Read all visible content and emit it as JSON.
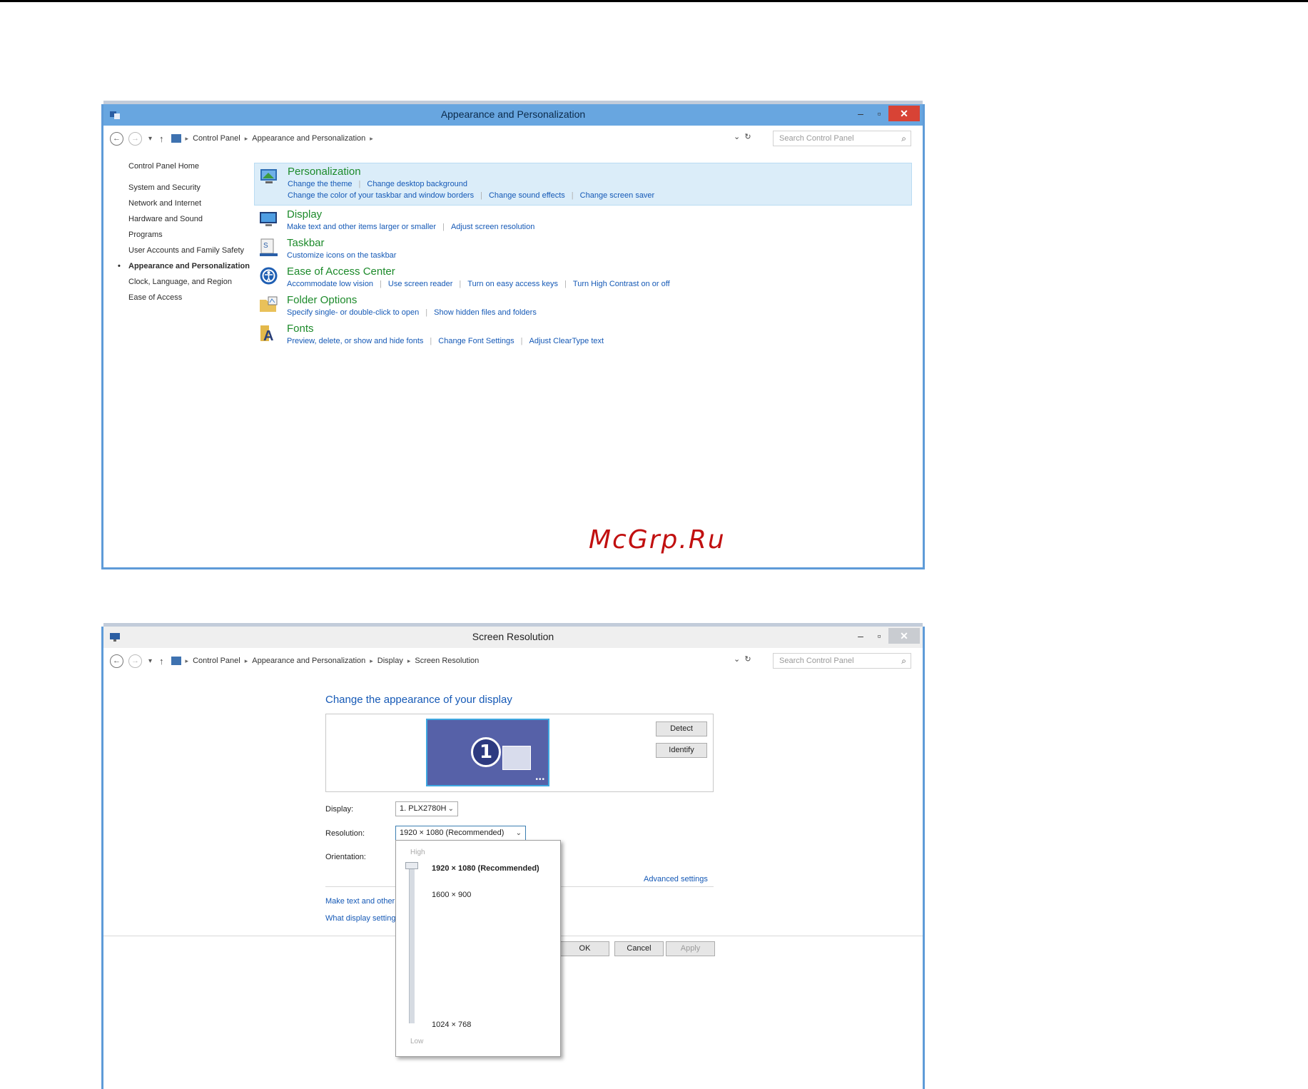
{
  "window1": {
    "title": "Appearance and Personalization",
    "breadcrumb": [
      "Control Panel",
      "Appearance and Personalization"
    ],
    "search_placeholder": "Search Control Panel",
    "sidebar": {
      "home": "Control Panel Home",
      "items": [
        "System and Security",
        "Network and Internet",
        "Hardware and Sound",
        "Programs",
        "User Accounts and Family Safety",
        "Appearance and Personalization",
        "Clock, Language, and Region",
        "Ease of Access"
      ],
      "current": "Appearance and Personalization"
    },
    "categories": [
      {
        "title": "Personalization",
        "icon": "personalization-icon",
        "links_row1": [
          "Change the theme",
          "Change desktop background"
        ],
        "links_row2": [
          "Change the color of your taskbar and window borders",
          "Change sound effects",
          "Change screen saver"
        ]
      },
      {
        "title": "Display",
        "icon": "display-icon",
        "links": [
          "Make text and other items larger or smaller",
          "Adjust screen resolution"
        ]
      },
      {
        "title": "Taskbar",
        "icon": "taskbar-icon",
        "links": [
          "Customize icons on the taskbar"
        ]
      },
      {
        "title": "Ease of Access Center",
        "icon": "ease-of-access-icon",
        "links": [
          "Accommodate low vision",
          "Use screen reader",
          "Turn on easy access keys",
          "Turn High Contrast on or off"
        ]
      },
      {
        "title": "Folder Options",
        "icon": "folder-options-icon",
        "links": [
          "Specify single- or double-click to open",
          "Show hidden files and folders"
        ]
      },
      {
        "title": "Fonts",
        "icon": "fonts-icon",
        "links": [
          "Preview, delete, or show and hide fonts",
          "Change Font Settings",
          "Adjust ClearType text"
        ]
      }
    ]
  },
  "watermark": "McGrp.Ru",
  "window2": {
    "title": "Screen Resolution",
    "breadcrumb": [
      "Control Panel",
      "Appearance and Personalization",
      "Display",
      "Screen Resolution"
    ],
    "search_placeholder": "Search Control Panel",
    "heading": "Change the appearance of your display",
    "monitor_number": "1",
    "detect": "Detect",
    "identify": "Identify",
    "display_label": "Display:",
    "display_value": "1. PLX2780H",
    "resolution_label": "Resolution:",
    "resolution_value": "1920 × 1080 (Recommended)",
    "orientation_label": "Orientation:",
    "advanced_settings": "Advanced settings",
    "link1": "Make text and other",
    "link2": "What display setting",
    "ok": "OK",
    "cancel": "Cancel",
    "apply": "Apply",
    "dropdown": {
      "high": "High",
      "low": "Low",
      "options": [
        "1920 × 1080 (Recommended)",
        "1600 × 900",
        "1024 × 768"
      ],
      "selected": "1920 × 1080 (Recommended)"
    }
  },
  "colors": {
    "accent": "#5e9bd8",
    "link": "#1559b6",
    "category_title": "#1c8a2a",
    "close": "#d84335"
  }
}
